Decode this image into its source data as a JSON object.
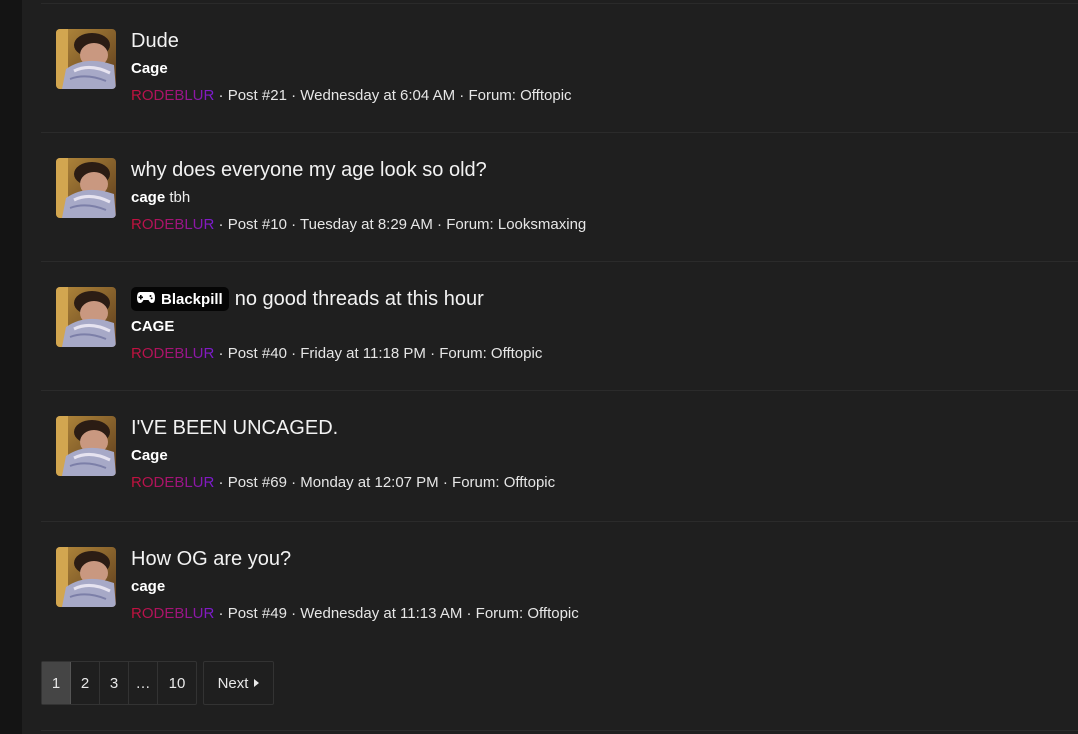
{
  "results": [
    {
      "title": "Dude",
      "prefix": "",
      "snippet_bold": "Cage",
      "snippet_rest": "",
      "user": "RODEBLUR",
      "post": "Post #21",
      "date": "Wednesday at 6:04 AM",
      "forum": "Forum: Offtopic"
    },
    {
      "title": "why does everyone my age look so old?",
      "prefix": "",
      "snippet_bold": "cage",
      "snippet_rest": " tbh",
      "user": "RODEBLUR",
      "post": "Post #10",
      "date": "Tuesday at 8:29 AM",
      "forum": "Forum: Looksmaxing"
    },
    {
      "title": "no good threads at this hour",
      "prefix": "Blackpill",
      "snippet_bold": "CAGE",
      "snippet_rest": "",
      "user": "RODEBLUR",
      "post": "Post #40",
      "date": "Friday at 11:18 PM",
      "forum": "Forum: Offtopic"
    },
    {
      "title": "I'VE BEEN UNCAGED.",
      "prefix": "",
      "snippet_bold": "Cage",
      "snippet_rest": "",
      "user": "RODEBLUR",
      "post": "Post #69",
      "date": "Monday at 12:07 PM",
      "forum": "Forum: Offtopic"
    },
    {
      "title": "How OG are you?",
      "prefix": "",
      "snippet_bold": "cage",
      "snippet_rest": "",
      "user": "RODEBLUR",
      "post": "Post #49",
      "date": "Wednesday at 11:13 AM",
      "forum": "Forum: Offtopic"
    }
  ],
  "separator": "·",
  "pagination": {
    "pages": [
      "1",
      "2",
      "3",
      "…",
      "10"
    ],
    "current": "1",
    "next_label": "Next"
  },
  "icons": {
    "avatar": "user-avatar-photo",
    "prefix": "gamepad-icon",
    "next": "caret-right-icon"
  }
}
